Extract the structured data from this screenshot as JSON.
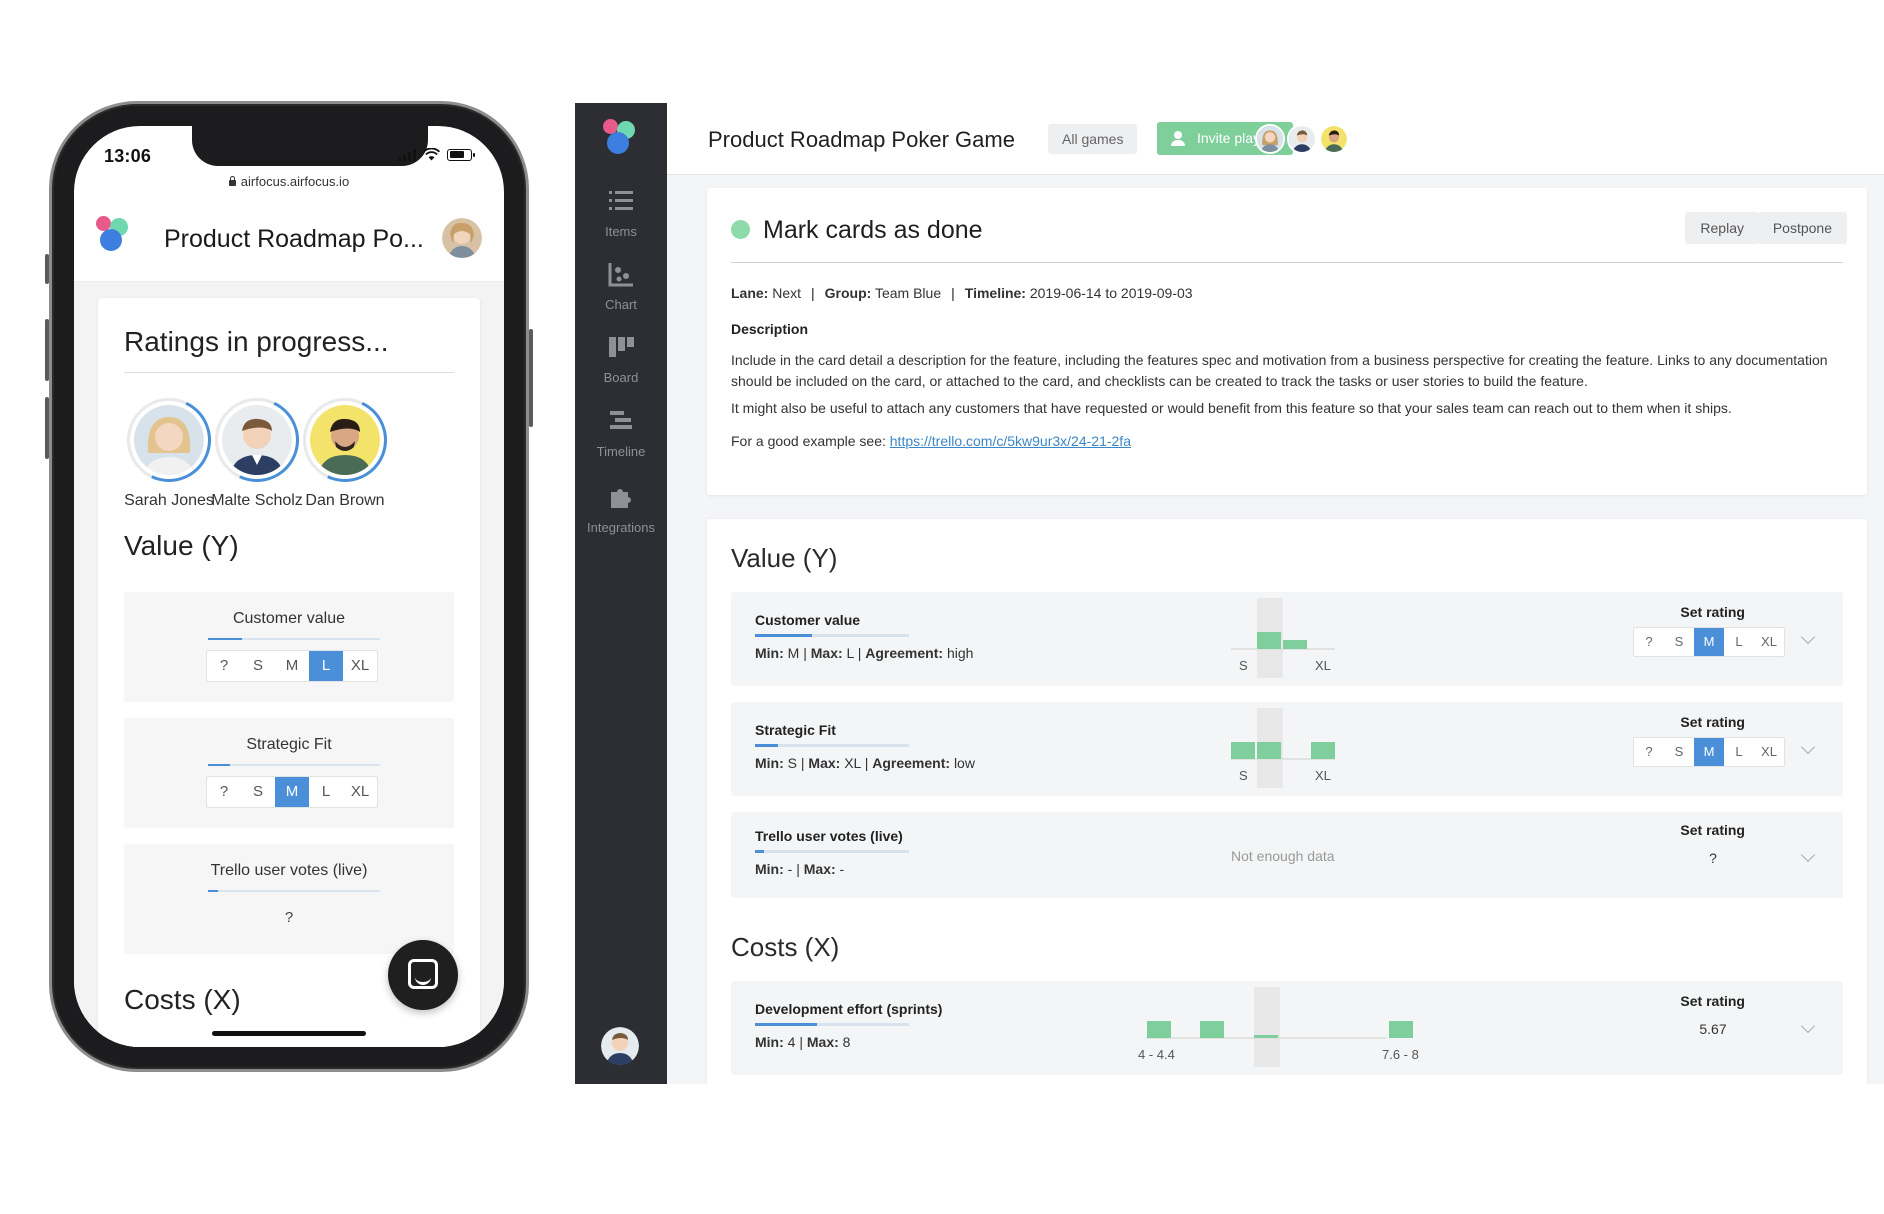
{
  "mobile": {
    "status_time": "13:06",
    "url": "airfocus.airfocus.io",
    "title": "Product Roadmap Po...",
    "ratings_title": "Ratings in progress...",
    "players": [
      {
        "name": "Sarah Jones"
      },
      {
        "name": "Malte Scholz"
      },
      {
        "name": "Dan Brown"
      }
    ],
    "value_title": "Value (Y)",
    "criteria": [
      {
        "label": "Customer value",
        "options": [
          "?",
          "S",
          "M",
          "L",
          "XL"
        ],
        "selected": "L",
        "progress": 0.2
      },
      {
        "label": "Strategic Fit",
        "options": [
          "?",
          "S",
          "M",
          "L",
          "XL"
        ],
        "selected": "M",
        "progress": 0.13
      },
      {
        "label": "Trello user votes (live)",
        "value": "?",
        "progress": 0.06
      }
    ],
    "costs_title": "Costs (X)"
  },
  "desktop": {
    "sidebar": {
      "items": [
        {
          "label": "Items",
          "icon": "list-icon"
        },
        {
          "label": "Chart",
          "icon": "chart-icon"
        },
        {
          "label": "Board",
          "icon": "board-icon"
        },
        {
          "label": "Timeline",
          "icon": "timeline-icon"
        },
        {
          "label": "Integrations",
          "icon": "puzzle-icon"
        }
      ]
    },
    "header": {
      "title": "Product Roadmap Poker Game",
      "all_games": "All games",
      "invite": "Invite players"
    },
    "card": {
      "title": "Mark cards as done",
      "replay": "Replay",
      "postpone": "Postpone",
      "lane_label": "Lane:",
      "lane": "Next",
      "group_label": "Group:",
      "group": "Team Blue",
      "timeline_label": "Timeline:",
      "timeline": "2019-06-14 to 2019-09-03",
      "description_heading": "Description",
      "p1": "Include in the card detail a description for the feature, including the features spec and motivation from a business perspective for creating the feature. Links to any documentation should be included on the card, or attached to the card, and checklists can be created to track the tasks or user stories to build the feature.",
      "p2": "It might also be useful to attach any customers that have requested or would benefit from this feature so that your sales team can reach out to them when it ships.",
      "p3_prefix": "For a good example see: ",
      "p3_link": "https://trello.com/c/5kw9ur3x/24-21-2fa"
    },
    "value_title": "Value (Y)",
    "costs_title": "Costs (X)",
    "set_rating": "Set rating",
    "rows": [
      {
        "name": "Customer value",
        "min": "M",
        "max": "L",
        "agreement": "high",
        "options": [
          "?",
          "S",
          "M",
          "L",
          "XL"
        ],
        "selected": "M",
        "progress": 0.37,
        "hist_left": "S",
        "hist_right": "XL"
      },
      {
        "name": "Strategic Fit",
        "min": "S",
        "max": "XL",
        "agreement": "low",
        "options": [
          "?",
          "S",
          "M",
          "L",
          "XL"
        ],
        "selected": "M",
        "progress": 0.15,
        "hist_left": "S",
        "hist_right": "XL"
      },
      {
        "name": "Trello user votes (live)",
        "min": "-",
        "max": "-",
        "value": "?",
        "no_data": "Not enough data",
        "progress": 0.06
      },
      {
        "name": "Development effort (sprints)",
        "min": "4",
        "max": "8",
        "value": "5.67",
        "progress": 0.4,
        "hist_left": "4 - 4.4",
        "hist_right": "7.6 - 8"
      }
    ],
    "labels": {
      "min": "Min:",
      "max": "Max:",
      "agreement": "Agreement:"
    }
  },
  "colors": {
    "accent": "#4a8fd8",
    "green": "#7fcf9c",
    "sidebar": "#2c2e33"
  }
}
